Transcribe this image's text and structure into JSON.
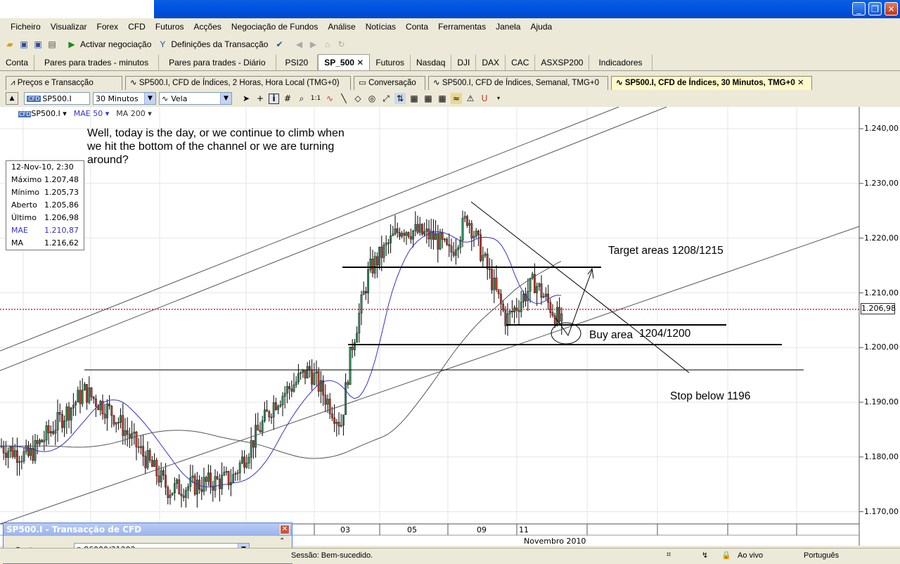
{
  "menu": [
    "Ficheiro",
    "Visualizar",
    "Forex",
    "CFD",
    "Futuros",
    "Acções",
    "Negociação de Fundos",
    "Análise",
    "Notícias",
    "Conta",
    "Ferramentas",
    "Janela",
    "Ajuda"
  ],
  "toolbar": {
    "activate_label": "Activar negociação",
    "settings_label": "Definições da Transacção"
  },
  "workspace_tabs": [
    "Conta",
    "Pares para trades - minutos",
    "Pares para trades - Diário",
    "PSI20",
    "SP_500",
    "Futuros",
    "Nasdaq",
    "DJI",
    "DAX",
    "CAC",
    "ASXSP200",
    "Indicadores"
  ],
  "active_workspace_tab": "SP_500",
  "chart_tabs": [
    "Preços e Transacção",
    "SP500.I, CFD de Índices, 2 Horas, Hora Local (TMG+0)",
    "Conversação",
    "SP500.I, CFD de Índices, Semanal, TMG+0",
    "SP500.I, CFD de Índices, 30 Minutos, TMG+0"
  ],
  "chart_toolbar": {
    "symbol": "SP500.I",
    "interval": "30 Minutos",
    "chart_type": "Vela"
  },
  "legend": {
    "symbol": "SP500.I",
    "indicator1": "MAE 50",
    "indicator2": "MA 200"
  },
  "note": "Well, today is the day, or we continue to climb when we hit the bottom of the channel or we are turning around?",
  "infobox": {
    "date": "12-Nov-10, 2:30",
    "rows": [
      {
        "label": "Máximo",
        "value": "1.207,48"
      },
      {
        "label": "Mínimo",
        "value": "1.205,73"
      },
      {
        "label": "Aberto",
        "value": "1.205,86"
      },
      {
        "label": "Último",
        "value": "1.206,98"
      },
      {
        "label": "MAE",
        "value": "1.210,87"
      },
      {
        "label": "MA",
        "value": "1.216,62"
      }
    ]
  },
  "annotations": {
    "target": "Target areas 1208/1215",
    "buy": "Buy area",
    "buy_values": "1204/1200",
    "stop": "Stop below 1196"
  },
  "y_ticks": [
    "1.240,00",
    "1.230,00",
    "1.220,00",
    "1.210,00",
    "1.200,00",
    "1.190,00",
    "1.180,00",
    "1.170,00"
  ],
  "current_price": "1.206,98",
  "x_ticks": [
    "03",
    "05",
    "09",
    "11"
  ],
  "month_label": "Novembro 2010",
  "dialog": {
    "title": "SP500.I - Transacção de CFD",
    "account_label": "Conta:",
    "account_value": "86000/31292"
  },
  "status": {
    "message": "Sessão: Bem-sucedido.",
    "live": "Ao vivo",
    "language": "Português"
  },
  "colors": {
    "titlebar": "#0054e3",
    "price_line": "#cc0000",
    "mae": "#3333cc",
    "ma": "#555555"
  }
}
